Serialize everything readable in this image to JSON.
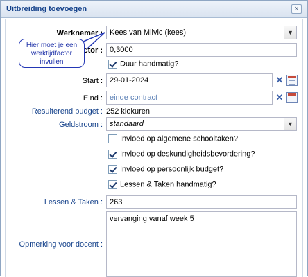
{
  "dialog": {
    "title": "Uitbreiding toevoegen",
    "close_symbol": "×"
  },
  "form": {
    "werknemer_label": "Werknemer :",
    "werknemer_value": "Kees van Mlivic (kees)",
    "werktijdfactor_label": "Werktijdfactor :",
    "werktijdfactor_value": "0,3000",
    "duur_handmatig_label": "Duur handmatig?",
    "duur_handmatig_checked": true,
    "start_label": "Start :",
    "start_value": "29-01-2024",
    "eind_label": "Eind :",
    "eind_placeholder": "einde contract",
    "resulterend_label": "Resulterend budget :",
    "resulterend_value": "252 klokuren",
    "geldstroom_label": "Geldstroom :",
    "geldstroom_value": "standaard",
    "checkboxes": [
      {
        "label": "Invloed op algemene schooltaken?",
        "checked": false
      },
      {
        "label": "Invloed op deskundigheidsbevordering?",
        "checked": true
      },
      {
        "label": "Invloed op persoonlijk budget?",
        "checked": true
      },
      {
        "label": "Lessen & Taken handmatig?",
        "checked": true
      }
    ],
    "lessen_label": "Lessen & Taken :",
    "lessen_value": "263",
    "opmerking_label": "Opmerking voor docent :",
    "opmerking_value": "vervanging vanaf week 5"
  },
  "annotation": {
    "line1": "Hier moet je een",
    "line2": "werktijdfactor",
    "line3": "invullen",
    "color": "#2337b5"
  },
  "icons": {
    "clear": "✕",
    "dropdown": "▼"
  }
}
